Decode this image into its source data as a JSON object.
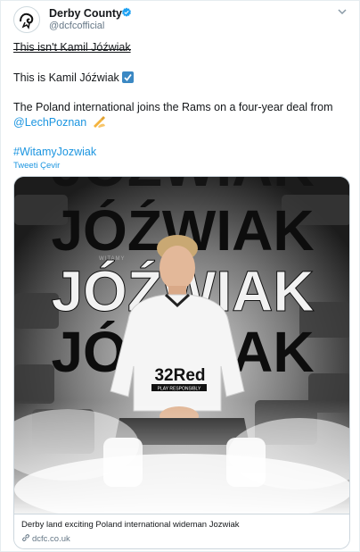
{
  "tweet": {
    "author": {
      "display_name": "Derby County",
      "handle": "@dcfcofficial",
      "verified": true
    },
    "line1": "This isn't Kamil Jóźwiak",
    "line2": "This is Kamil Jóźwiak",
    "line3_pre": "The Poland international joins the Rams on a four-year deal from",
    "mention": "@LechPoznan",
    "hashtag": "#WitamyJozwiak",
    "translate_label": "Tweeti Çevir"
  },
  "card": {
    "image": {
      "headline": "JÓŹWIAK",
      "small_tag": "WITAMY",
      "shirt_sponsor": "32Red",
      "shirt_sub": "PLAY RESPONSIBLY"
    },
    "title": "Derby land exciting Poland international wideman Jozwiak",
    "domain": "dcfc.co.uk"
  },
  "colors": {
    "link": "#1b95e0",
    "text": "#14171a",
    "secondary": "#657786",
    "verified": "#1da1f2"
  },
  "icons": [
    "ram-crest-icon",
    "verified-icon",
    "chevron-down-icon",
    "check-box-emoji-icon",
    "writing-hand-emoji-icon",
    "link-icon"
  ]
}
